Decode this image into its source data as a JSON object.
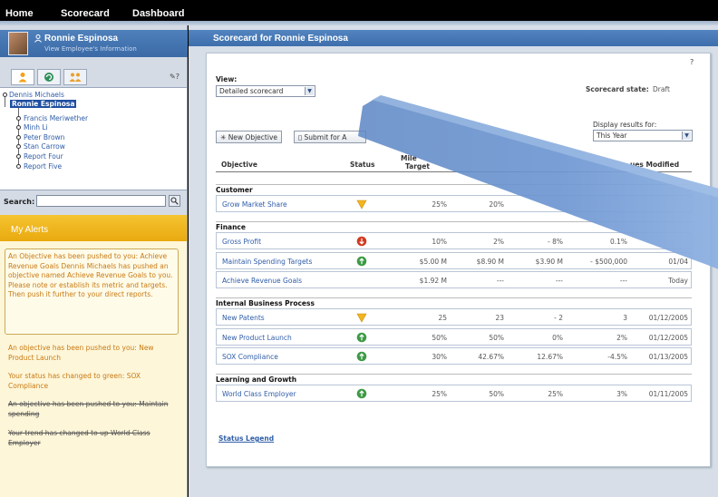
{
  "nav": {
    "home": "Home",
    "scorecard": "Scorecard",
    "dashboard": "Dashboard"
  },
  "user": {
    "name": "Ronnie Espinosa",
    "link": "View Employee's Information"
  },
  "sidebar": {
    "help": "?",
    "tree": [
      "Dennis Michaels",
      "Ronnie Espinosa",
      "Francis Meriwether",
      "Minh Li",
      "Peter Brown",
      "Stan Carrow",
      "Report Four",
      "Report Five"
    ],
    "search_label": "Search:",
    "alerts_title": "My Alerts",
    "alert_box": "An Objective has been pushed to you: Achieve Revenue Goals Dennis Michaels has pushed an objective named Achieve Revenue Goals to you. Please note or establish its metric and targets. Then push it further to your direct reports.",
    "alerts": [
      {
        "text": "An objective has been pushed to you: New Product Launch",
        "struck": false
      },
      {
        "text": "Your  status has changed to green: SOX Compliance",
        "struck": false
      },
      {
        "text": "An objective has been pushed to you: Maintain spending",
        "struck": true
      },
      {
        "text": "Your trend has changed to up World Class Employer",
        "struck": true
      }
    ]
  },
  "main": {
    "title": "Scorecard for Ronnie Espinosa",
    "help": "?",
    "view_label": "View:",
    "view_value": "Detailed scorecard",
    "state_label": "Scorecard state:",
    "state_value": "Draft",
    "display_label": "Display results for:",
    "display_value": "This Year",
    "btn_new": "New Objective",
    "btn_submit": "Submit for A",
    "col_objective": "Objective",
    "col_status": "Status",
    "col_mile1": "Mile",
    "col_mile2": "Target",
    "col_modified": "ues Modified",
    "legend": "Status Legend",
    "sections": [
      {
        "name": "Customer",
        "rows": [
          {
            "name": "Grow Market Share",
            "status": "yellow",
            "v1": "25%",
            "v2": "20%",
            "v3": "",
            "v4": "",
            "v5": ""
          }
        ]
      },
      {
        "name": "Finance",
        "rows": [
          {
            "name": "Gross Profit",
            "status": "red",
            "v1": "10%",
            "v2": "2%",
            "v3": "- 8%",
            "v4": "0.1%",
            "v5": ""
          },
          {
            "name": "Maintain Spending Targets",
            "status": "green",
            "v1": "$5.00 M",
            "v2": "$8.90 M",
            "v3": "$3.90 M",
            "v4": "- $500,000",
            "v5": "01/04"
          },
          {
            "name": "Achieve Revenue Goals",
            "status": "",
            "v1": "$1.92 M",
            "v2": "---",
            "v3": "---",
            "v4": "---",
            "v5": "Today"
          }
        ]
      },
      {
        "name": "Internal Business Process",
        "rows": [
          {
            "name": "New Patents",
            "status": "yellow",
            "v1": "25",
            "v2": "23",
            "v3": "- 2",
            "v4": "3",
            "v5": "01/12/2005"
          },
          {
            "name": "New Product Launch",
            "status": "green",
            "v1": "50%",
            "v2": "50%",
            "v3": "0%",
            "v4": "2%",
            "v5": "01/12/2005"
          },
          {
            "name": "SOX Compliance",
            "status": "green",
            "v1": "30%",
            "v2": "42.67%",
            "v3": "12.67%",
            "v4": "-4.5%",
            "v5": "01/13/2005"
          }
        ]
      },
      {
        "name": "Learning and Growth",
        "rows": [
          {
            "name": "World Class Employer",
            "status": "green",
            "v1": "25%",
            "v2": "50%",
            "v3": "25%",
            "v4": "3%",
            "v5": "01/11/2005"
          }
        ]
      }
    ]
  },
  "colors": {
    "nav_bg": "#000000",
    "header_blue": "#4a7bb7",
    "alerts_yellow": "#f0b820",
    "link_blue": "#2f5da8",
    "alert_orange": "#c77a14"
  }
}
